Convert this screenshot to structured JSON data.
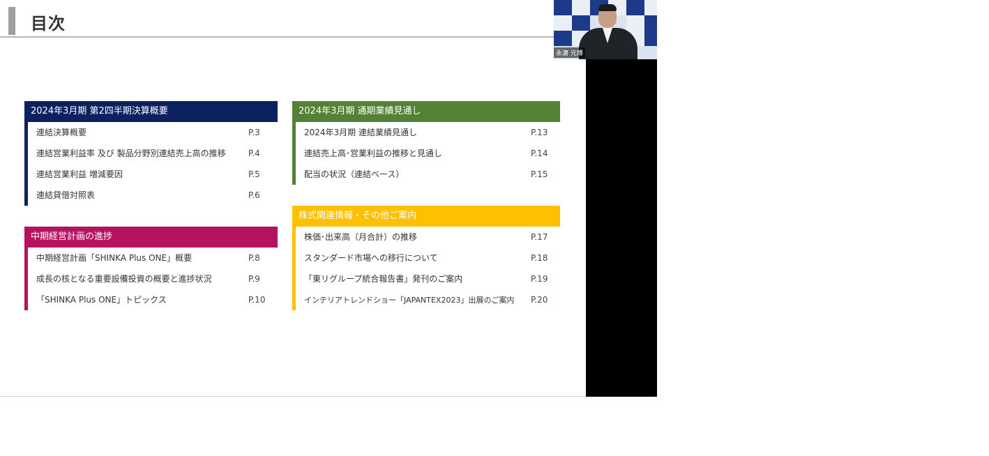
{
  "slide": {
    "title": "目次"
  },
  "video": {
    "participant_name": "永濵 元博"
  },
  "sections": {
    "s1": {
      "header": "2024年3月期 第2四半期決算概要",
      "color": "#0d2160",
      "items": [
        {
          "label": "連結決算概要",
          "page": "P.3"
        },
        {
          "label": "連結営業利益率 及び 製品分野別連結売上高の推移",
          "page": "P.4"
        },
        {
          "label": "連結営業利益 増減要因",
          "page": "P.5"
        },
        {
          "label": "連結貸借対照表",
          "page": "P.6"
        }
      ]
    },
    "s2": {
      "header": "中期経営計画の進捗",
      "color": "#b5125f",
      "items": [
        {
          "label": "中期経営計画「SHINKA Plus ONE」概要",
          "page": "P.8"
        },
        {
          "label": "成長の核となる重要設備投資の概要と進捗状況",
          "page": "P.9"
        },
        {
          "label": "「SHINKA Plus ONE」トピックス",
          "page": "P.10"
        }
      ]
    },
    "s3": {
      "header": "2024年3月期 通期業績見通し",
      "color": "#548235",
      "items": [
        {
          "label": "2024年3月期 連結業績見通し",
          "page": "P.13"
        },
        {
          "label": "連結売上高･営業利益の推移と見通し",
          "page": "P.14"
        },
        {
          "label": "配当の状況（連結ベース）",
          "page": "P.15"
        }
      ]
    },
    "s4": {
      "header": "株式関連情報・その他ご案内",
      "color": "#ffc000",
      "items": [
        {
          "label": "株価･出来高（月合計）の推移",
          "page": "P.17"
        },
        {
          "label": "スタンダード市場への移行について",
          "page": "P.18"
        },
        {
          "label": "「東リグループ統合報告書」発刊のご案内",
          "page": "P.19"
        },
        {
          "label": "インテリアトレンドショー「JAPANTEX2023」出展のご案内",
          "page": "P.20"
        }
      ]
    }
  }
}
